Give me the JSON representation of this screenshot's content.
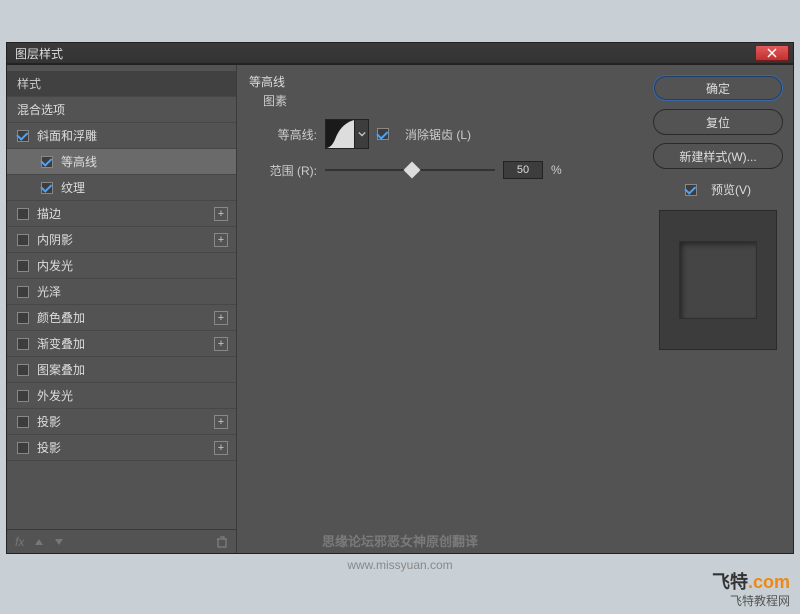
{
  "window": {
    "title": "图层样式"
  },
  "styles": {
    "header": "样式",
    "blend_options": "混合选项",
    "items": [
      {
        "label": "斜面和浮雕",
        "checked": true,
        "has_plus": false,
        "sub": false,
        "selected": false
      },
      {
        "label": "等高线",
        "checked": true,
        "has_plus": false,
        "sub": true,
        "selected": true
      },
      {
        "label": "纹理",
        "checked": true,
        "has_plus": false,
        "sub": true,
        "selected": false
      },
      {
        "label": "描边",
        "checked": false,
        "has_plus": true,
        "sub": false,
        "selected": false
      },
      {
        "label": "内阴影",
        "checked": false,
        "has_plus": true,
        "sub": false,
        "selected": false
      },
      {
        "label": "内发光",
        "checked": false,
        "has_plus": false,
        "sub": false,
        "selected": false
      },
      {
        "label": "光泽",
        "checked": false,
        "has_plus": false,
        "sub": false,
        "selected": false
      },
      {
        "label": "颜色叠加",
        "checked": false,
        "has_plus": true,
        "sub": false,
        "selected": false
      },
      {
        "label": "渐变叠加",
        "checked": false,
        "has_plus": true,
        "sub": false,
        "selected": false
      },
      {
        "label": "图案叠加",
        "checked": false,
        "has_plus": false,
        "sub": false,
        "selected": false
      },
      {
        "label": "外发光",
        "checked": false,
        "has_plus": false,
        "sub": false,
        "selected": false
      },
      {
        "label": "投影",
        "checked": false,
        "has_plus": true,
        "sub": false,
        "selected": false
      },
      {
        "label": "投影",
        "checked": false,
        "has_plus": true,
        "sub": false,
        "selected": false
      }
    ],
    "footer_fx": "fx"
  },
  "center": {
    "group_title": "等高线",
    "subtitle": "图素",
    "contour_label": "等高线:",
    "antialias_label": "消除锯齿 (L)",
    "antialias_checked": true,
    "range_label": "范围 (R):",
    "range_value": "50",
    "range_unit": "%"
  },
  "right": {
    "ok": "确定",
    "reset": "复位",
    "new_style": "新建样式(W)...",
    "preview_label": "预览(V)",
    "preview_checked": true
  },
  "watermark": {
    "line1": "思缘论坛邪恶女神原创翻译",
    "line2": "www.missyuan.com"
  },
  "brand": {
    "line1a": "飞特",
    "line1b": ".com",
    "line2": "飞特教程网"
  }
}
